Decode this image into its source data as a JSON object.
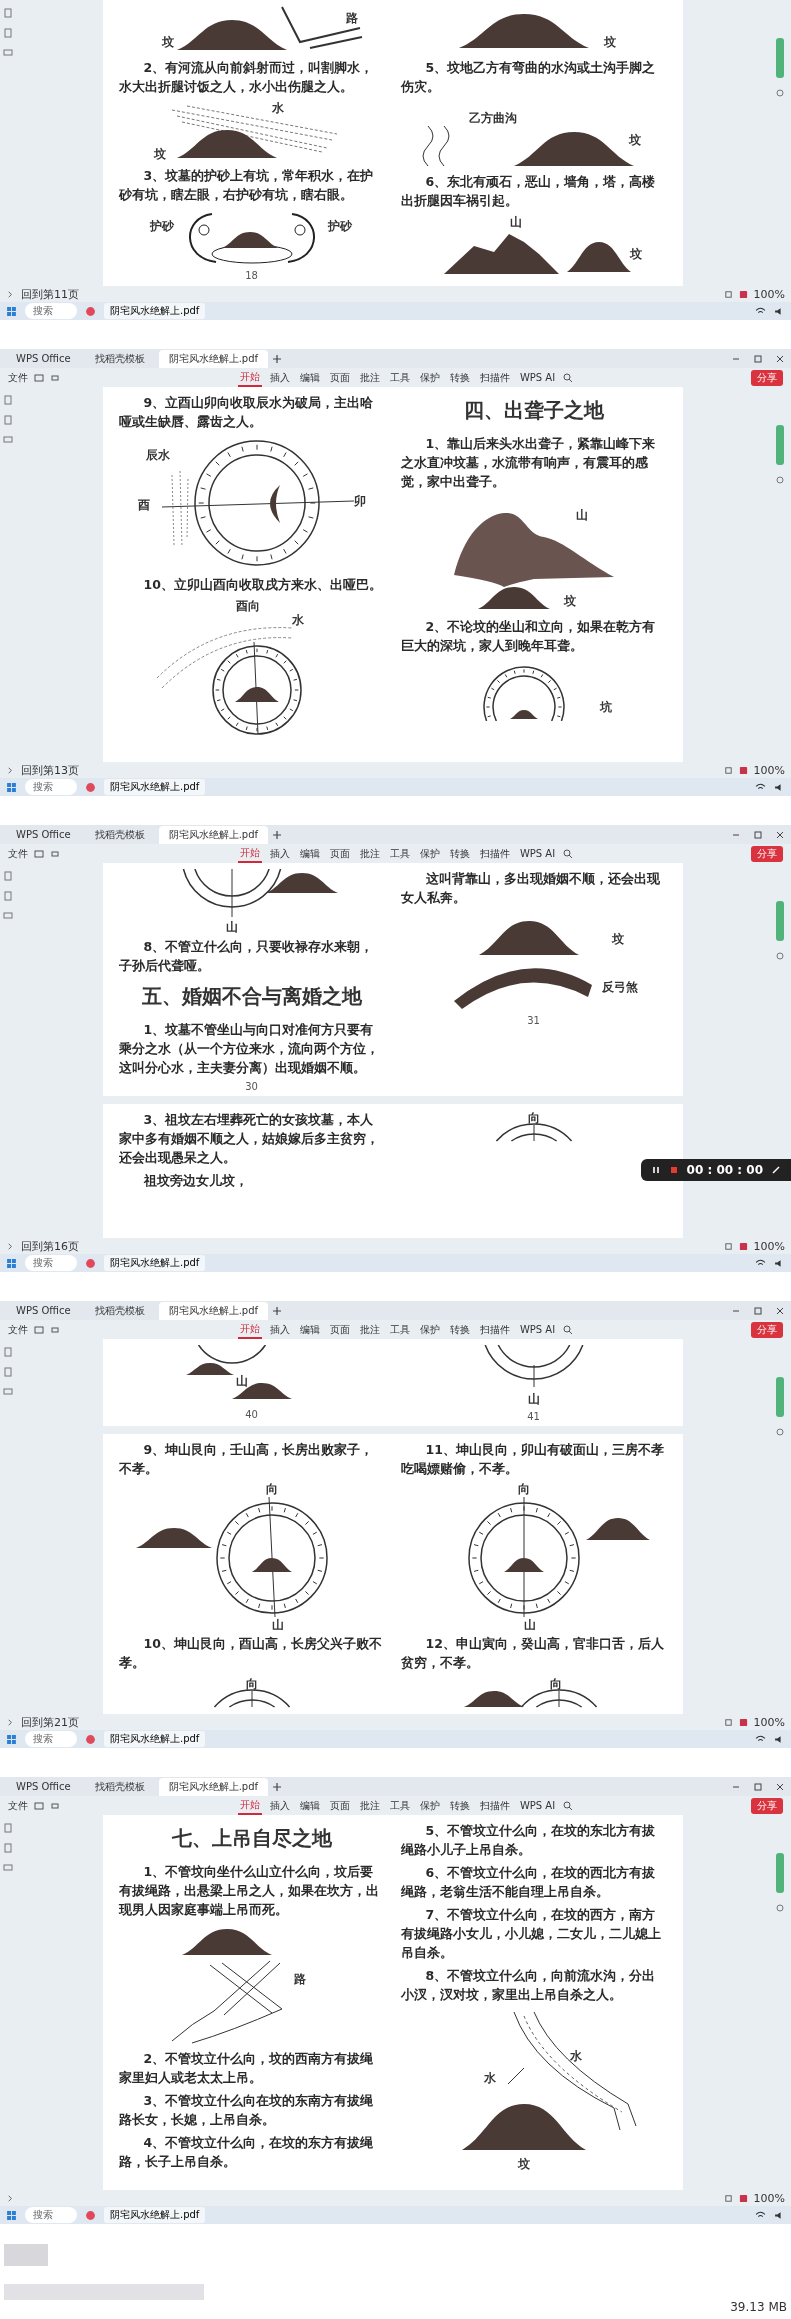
{
  "panels": [
    {
      "sheets": [
        {
          "columns": [
            [
              {
                "kind": "mound-road",
                "labels": [
                  "坟",
                  "路"
                ]
              },
              {
                "kind": "para",
                "text": "2、有河流从向前斜射而过，叫割脚水，水大出折腿讨饭之人，水小出伤腿之人。"
              },
              {
                "kind": "mound-water",
                "labels": [
                  "水",
                  "坟"
                ]
              },
              {
                "kind": "para",
                "text": "3、坟墓的护砂上有坑，常年积水，在护砂有坑，瞎左眼，右护砂有坑，瞎右眼。"
              },
              {
                "kind": "mound-pit",
                "labels": [
                  "护砂",
                  "护砂"
                ]
              },
              {
                "kind": "pagenum",
                "text": "18"
              }
            ],
            [
              {
                "kind": "mound",
                "labels": [
                  "坟"
                ]
              },
              {
                "kind": "para",
                "text": "5、坟地乙方有弯曲的水沟或土沟手脚之伤灾。"
              },
              {
                "kind": "ditch-mound",
                "labels": [
                  "乙方曲沟",
                  "坟"
                ]
              },
              {
                "kind": "para",
                "text": "6、东北有顽石，恶山，墙角，塔，高楼出折腿因车祸引起。"
              },
              {
                "kind": "mountain-mound",
                "labels": [
                  "山",
                  "坟"
                ]
              }
            ]
          ]
        }
      ],
      "status": "回到第11页",
      "zoom": "100%",
      "search": "搜索",
      "app": "阴宅风水绝解上.pdf"
    },
    {
      "tabs": [
        {
          "label": "WPS Office",
          "selected": false
        },
        {
          "label": "找稻壳模板",
          "selected": false
        },
        {
          "label": "阴宅风水绝解上.pdf",
          "selected": true
        }
      ],
      "file": "文件",
      "menu": [
        {
          "label": "开始",
          "selected": true
        },
        {
          "label": "插入",
          "selected": false
        },
        {
          "label": "编辑",
          "selected": false
        },
        {
          "label": "页面",
          "selected": false
        },
        {
          "label": "批注",
          "selected": false
        },
        {
          "label": "工具",
          "selected": false
        },
        {
          "label": "保护",
          "selected": false
        },
        {
          "label": "转换",
          "selected": false
        },
        {
          "label": "扫描件",
          "selected": false
        },
        {
          "label": "WPS AI",
          "selected": false
        }
      ],
      "share": "分享",
      "sheets": [
        {
          "columns": [
            [
              {
                "kind": "para",
                "text": "9、立酉山卯向收取辰水为破局，主出哈哑或生缺唇、露齿之人。"
              },
              {
                "kind": "compass-water",
                "labels": [
                  "辰水",
                  "酉",
                  "卯"
                ]
              },
              {
                "kind": "para",
                "text": "10、立卯山酉向收取戌方来水、出哑巴。"
              },
              {
                "kind": "compass-water-top",
                "labels": [
                  "酉向",
                  "水"
                ]
              }
            ],
            [
              {
                "kind": "heading",
                "text": "四、出聋子之地"
              },
              {
                "kind": "para",
                "text": "1、靠山后来头水出聋子，紧靠山峰下来之水直冲坟墓，水流带有响声，有震耳的感觉，家中出聋子。"
              },
              {
                "kind": "mountain-over-mound",
                "labels": [
                  "山",
                  "坟"
                ]
              },
              {
                "kind": "para",
                "text": "2、不论坟的坐山和立向，如果在乾方有巨大的深坑，家人到晚年耳聋。"
              },
              {
                "kind": "compass-pit",
                "labels": [
                  "坑"
                ]
              }
            ]
          ]
        }
      ],
      "status": "回到第13页",
      "zoom": "100%",
      "search": "搜索",
      "app": "阴宅风水绝解上.pdf"
    },
    {
      "tabs": [
        {
          "label": "WPS Office",
          "selected": false
        },
        {
          "label": "找稻壳模板",
          "selected": false
        },
        {
          "label": "阴宅风水绝解上.pdf",
          "selected": true
        }
      ],
      "file": "文件",
      "menu": [
        {
          "label": "开始",
          "selected": true
        },
        {
          "label": "插入",
          "selected": false
        },
        {
          "label": "编辑",
          "selected": false
        },
        {
          "label": "页面",
          "selected": false
        },
        {
          "label": "批注",
          "selected": false
        },
        {
          "label": "工具",
          "selected": false
        },
        {
          "label": "保护",
          "selected": false
        },
        {
          "label": "转换",
          "selected": false
        },
        {
          "label": "扫描件",
          "selected": false
        },
        {
          "label": "WPS AI",
          "selected": false
        }
      ],
      "share": "分享",
      "sheets": [
        {
          "columns": [
            [
              {
                "kind": "compass-bottom-hill",
                "labels": [
                  "山"
                ]
              },
              {
                "kind": "para",
                "text": "8、不管立什么向，只要收禄存水来朝，子孙后代聋哑。"
              },
              {
                "kind": "heading",
                "text": "五、婚姻不合与离婚之地"
              },
              {
                "kind": "para",
                "text": "1、坟墓不管坐山与向口对准何方只要有乘分之水（从一个方位来水，流向两个方位，这叫分心水，主夫妻分离）出现婚姻不顺。"
              },
              {
                "kind": "pagenum",
                "text": "30"
              }
            ],
            [
              {
                "kind": "para",
                "text": "这叫背靠山，多出现婚姻不顺，还会出现女人私奔。"
              },
              {
                "kind": "mound-arc",
                "labels": [
                  "坟",
                  "反弓煞"
                ]
              },
              {
                "kind": "pagenum",
                "text": "31"
              }
            ]
          ]
        },
        {
          "columns": [
            [
              {
                "kind": "para",
                "text": "3、祖坟左右埋葬死亡的女孩坟墓，本人家中多有婚姻不顺之人，姑娘嫁后多主贫穷，还会出现愚呆之人。"
              },
              {
                "kind": "para",
                "text": "祖坟旁边女儿坟，"
              }
            ],
            [
              {
                "kind": "compass-top",
                "labels": [
                  "向"
                ]
              }
            ]
          ]
        }
      ],
      "recorder": {
        "time": "00 : 00 : 00"
      },
      "status": "回到第16页",
      "zoom": "100%",
      "search": "搜索",
      "app": "阴宅风水绝解上.pdf"
    },
    {
      "tabs": [
        {
          "label": "WPS Office",
          "selected": false
        },
        {
          "label": "找稻壳模板",
          "selected": false
        },
        {
          "label": "阴宅风水绝解上.pdf",
          "selected": true
        }
      ],
      "file": "文件",
      "menu": [
        {
          "label": "开始",
          "selected": true
        },
        {
          "label": "插入",
          "selected": false
        },
        {
          "label": "编辑",
          "selected": false
        },
        {
          "label": "页面",
          "selected": false
        },
        {
          "label": "批注",
          "selected": false
        },
        {
          "label": "工具",
          "selected": false
        },
        {
          "label": "保护",
          "selected": false
        },
        {
          "label": "转换",
          "selected": false
        },
        {
          "label": "扫描件",
          "selected": false
        },
        {
          "label": "WPS AI",
          "selected": false
        }
      ],
      "share": "分享",
      "sheets": [
        {
          "columns": [
            [
              {
                "kind": "compass-bottom-mounds",
                "labels": [
                  "山"
                ]
              },
              {
                "kind": "pagenum",
                "text": "40"
              }
            ],
            [
              {
                "kind": "compass-bottom",
                "labels": [
                  "山"
                ]
              },
              {
                "kind": "pagenum",
                "text": "41"
              }
            ]
          ]
        },
        {
          "columns": [
            [
              {
                "kind": "para",
                "text": "9、坤山艮向，壬山高，长房出败家子，不孝。"
              },
              {
                "kind": "compass-hill",
                "labels": [
                  "向",
                  "山"
                ]
              },
              {
                "kind": "para",
                "text": "10、坤山艮向，酉山高，长房父兴子败不孝。"
              },
              {
                "kind": "compass-top",
                "labels": [
                  "向"
                ]
              }
            ],
            [
              {
                "kind": "para",
                "text": "11、坤山艮向，卯山有破面山，三房不孝吃喝嫖赌偷，不孝。"
              },
              {
                "kind": "compass-hill-right",
                "labels": [
                  "向",
                  "山"
                ]
              },
              {
                "kind": "para",
                "text": "12、申山寅向，癸山高，官非口舌，后人贫穷，不孝。"
              },
              {
                "kind": "compass-top-mound",
                "labels": [
                  "向"
                ]
              }
            ]
          ]
        }
      ],
      "status": "回到第21页",
      "zoom": "100%",
      "search": "搜索",
      "app": "阴宅风水绝解上.pdf"
    },
    {
      "tabs": [
        {
          "label": "WPS Office",
          "selected": false
        },
        {
          "label": "找稻壳模板",
          "selected": false
        },
        {
          "label": "阴宅风水绝解上.pdf",
          "selected": true
        }
      ],
      "file": "文件",
      "menu": [
        {
          "label": "开始",
          "selected": true
        },
        {
          "label": "插入",
          "selected": false
        },
        {
          "label": "编辑",
          "selected": false
        },
        {
          "label": "页面",
          "selected": false
        },
        {
          "label": "批注",
          "selected": false
        },
        {
          "label": "工具",
          "selected": false
        },
        {
          "label": "保护",
          "selected": false
        },
        {
          "label": "转换",
          "selected": false
        },
        {
          "label": "扫描件",
          "selected": false
        },
        {
          "label": "WPS AI",
          "selected": false
        }
      ],
      "share": "分享",
      "sheets": [
        {
          "columns": [
            [
              {
                "kind": "heading",
                "text": "七、上吊自尽之地"
              },
              {
                "kind": "para",
                "text": "1、不管坟向坐什么山立什么向，坟后要有拔绳路，出悬梁上吊之人，如果在坎方，出现男人因家庭事端上吊而死。"
              },
              {
                "kind": "crossing-roads",
                "labels": [
                  "路"
                ]
              },
              {
                "kind": "para",
                "text": "2、不管坟立什么向，坟的西南方有拔绳家里妇人或老太太上吊。"
              },
              {
                "kind": "para",
                "text": "3、不管坟立什么向在坟的东南方有拔绳路长女，长媳，上吊自杀。"
              },
              {
                "kind": "para",
                "text": "4、不管坟立什么向，在坟的东方有拔绳路，长子上吊自杀。"
              }
            ],
            [
              {
                "kind": "para",
                "text": "5、不管坟立什么向，在坟的东北方有拔绳路小儿子上吊自杀。"
              },
              {
                "kind": "para",
                "text": "6、不管坟立什么向，在坟的西北方有拔绳路，老翁生活不能自理上吊自杀。"
              },
              {
                "kind": "para",
                "text": "7、不管坟立什么向，在坟的西方，南方有拔绳路小女儿，小儿媳，二女儿，二儿媳上吊自杀。"
              },
              {
                "kind": "para",
                "text": "8、不管坟立什么向，向前流水沟，分出小汊，汊对坟，家里出上吊自杀之人。"
              },
              {
                "kind": "river-mound",
                "labels": [
                  "水",
                  "水",
                  "坟"
                ]
              }
            ]
          ]
        }
      ],
      "zoom": "100%",
      "search": "搜索",
      "app": "阴宅风水绝解上.pdf"
    }
  ],
  "file_size": "39.13 MB"
}
